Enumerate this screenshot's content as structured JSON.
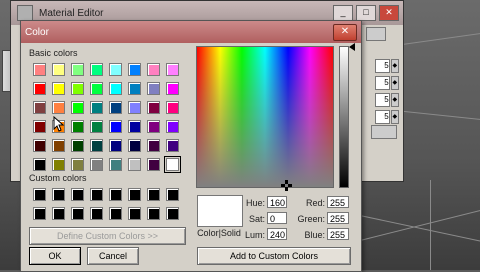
{
  "material_editor": {
    "title": "Material Editor",
    "window_buttons": [
      "_",
      "□",
      "✕"
    ],
    "side_values": [
      "5",
      "5",
      "5",
      "5"
    ]
  },
  "color_dialog": {
    "title": "Color",
    "close_label": "✕",
    "basic_colors_label": "Basic colors",
    "custom_colors_label": "Custom colors",
    "define_custom_label": "Define Custom Colors >>",
    "ok_label": "OK",
    "cancel_label": "Cancel",
    "add_custom_label": "Add to Custom Colors",
    "color_solid_label": "Color|Solid",
    "hue_label": "Hue:",
    "hue_value": "160",
    "sat_label": "Sat:",
    "sat_value": "0",
    "lum_label": "Lum:",
    "lum_value": "240",
    "red_label": "Red:",
    "red_value": "255",
    "green_label": "Green:",
    "green_value": "255",
    "blue_label": "Blue:",
    "blue_value": "255",
    "basic_colors": [
      [
        "#ff8080",
        "#ffff80",
        "#80ff80",
        "#00ff80",
        "#80ffff",
        "#0080ff",
        "#ff80c0",
        "#ff80ff"
      ],
      [
        "#ff0000",
        "#ffff00",
        "#80ff00",
        "#00ff40",
        "#00ffff",
        "#0080c0",
        "#8080c0",
        "#ff00ff"
      ],
      [
        "#804040",
        "#ff8040",
        "#00ff00",
        "#008080",
        "#004080",
        "#8080ff",
        "#800040",
        "#ff0080"
      ],
      [
        "#800000",
        "#ff8000",
        "#008000",
        "#008040",
        "#0000ff",
        "#0000a0",
        "#800080",
        "#8000ff"
      ],
      [
        "#400000",
        "#804000",
        "#004000",
        "#004040",
        "#000080",
        "#000040",
        "#400040",
        "#400080"
      ],
      [
        "#000000",
        "#808000",
        "#808040",
        "#808080",
        "#408080",
        "#c0c0c0",
        "#400040",
        "#ffffff"
      ]
    ],
    "custom_colors": [
      [
        "#000000",
        "#000000",
        "#000000",
        "#000000",
        "#000000",
        "#000000",
        "#000000",
        "#000000"
      ],
      [
        "#000000",
        "#000000",
        "#000000",
        "#000000",
        "#000000",
        "#000000",
        "#000000",
        "#000000"
      ]
    ]
  }
}
